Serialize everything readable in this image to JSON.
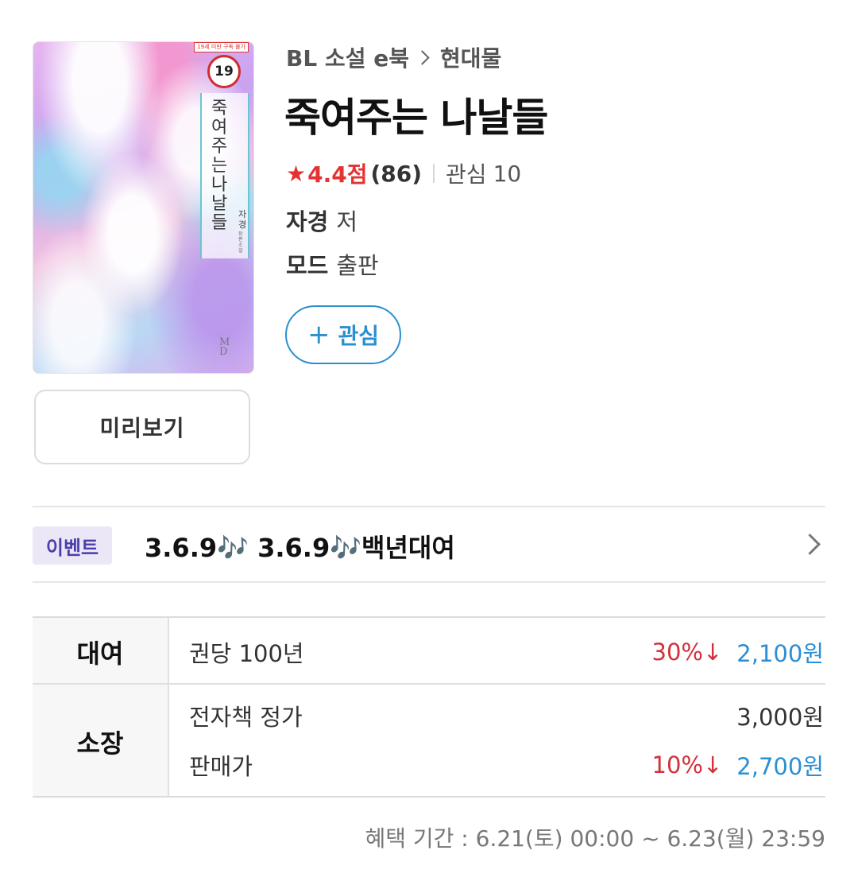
{
  "cover": {
    "age_banner": "19세 미만 구독 불가",
    "age_badge": "19",
    "title_vertical": "죽여주는 나날들",
    "author_vertical": "자경",
    "sub_vertical": "장편소설",
    "publisher_mark": "MD"
  },
  "preview_button": "미리보기",
  "breadcrumb": {
    "category": "BL 소설 e북",
    "subcategory": "현대물"
  },
  "title": "죽여주는 나날들",
  "rating": {
    "star_icon": "star-icon",
    "score": "4.4점",
    "count": "(86)"
  },
  "interest": {
    "label": "관심",
    "count": "10"
  },
  "author": {
    "name": "자경",
    "role": "저"
  },
  "publisher": {
    "name": "모드",
    "role": "출판"
  },
  "follow_button": {
    "icon": "+",
    "label": "관심"
  },
  "event": {
    "tag": "이벤트",
    "text": "3.6.9🎶 3.6.9🎶백년대여"
  },
  "pricing": {
    "rent": {
      "label": "대여",
      "desc": "권당 100년",
      "discount": "30%↓",
      "price": "2,100원"
    },
    "own": {
      "label": "소장",
      "list_label": "전자책 정가",
      "list_price": "3,000원",
      "sale_label": "판매가",
      "discount": "10%↓",
      "price": "2,700원"
    }
  },
  "benefit_period": "혜택 기간 : 6.21(토) 00:00 ~ 6.23(월) 23:59",
  "colors": {
    "accent_blue": "#2a8fcf",
    "discount_red": "#d2313b",
    "event_tag_bg": "#ebe7f7"
  }
}
